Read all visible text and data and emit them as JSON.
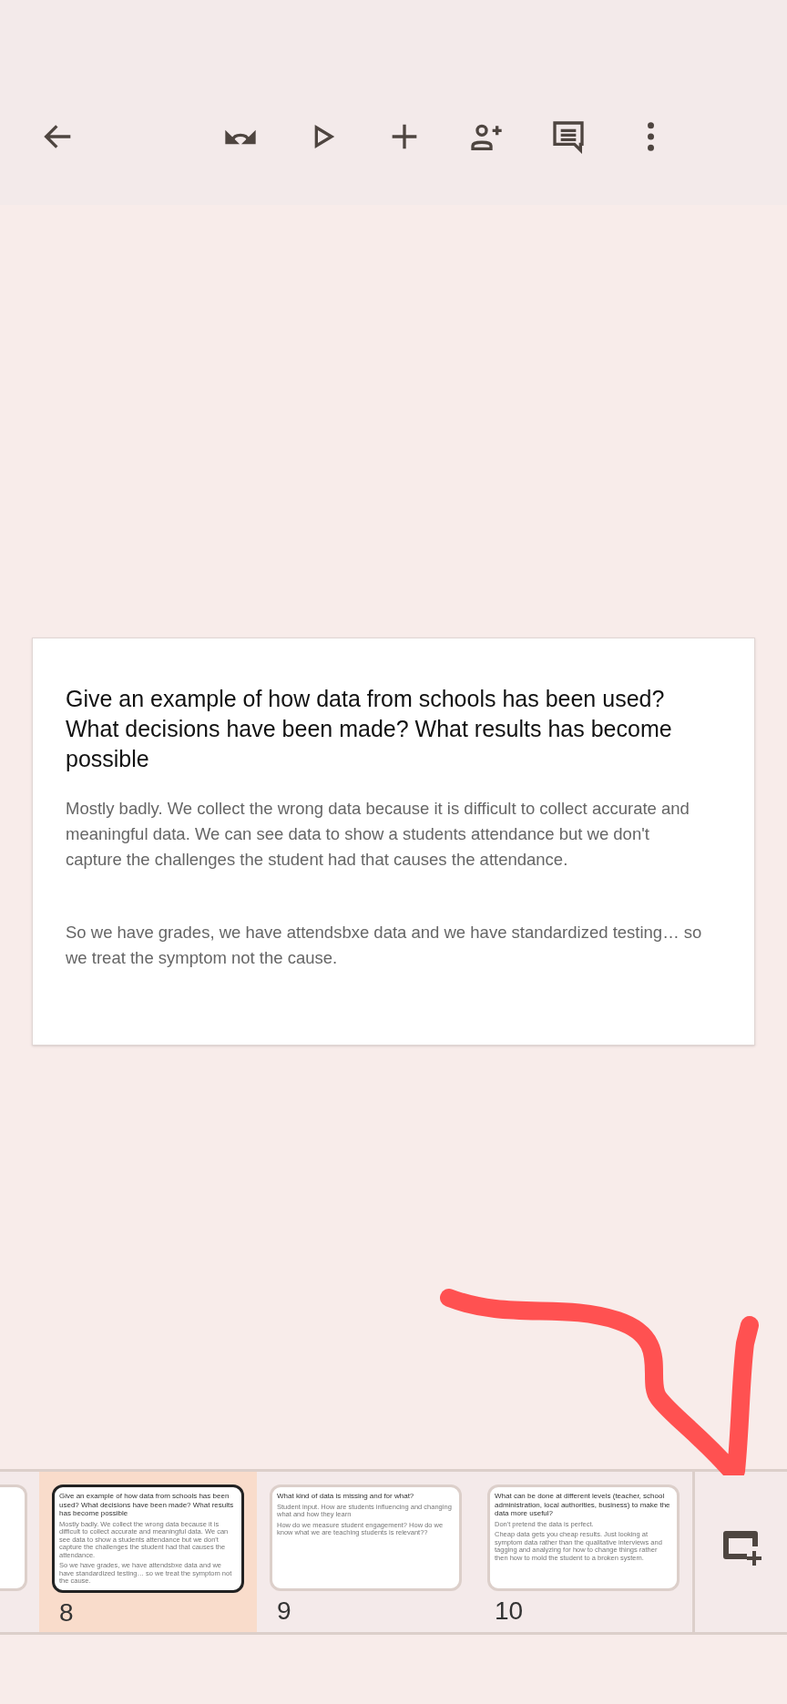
{
  "toolbar": {
    "buttons": [
      {
        "kind": "back"
      },
      {
        "kind": "undo"
      },
      {
        "kind": "play"
      },
      {
        "kind": "add"
      },
      {
        "kind": "share"
      },
      {
        "kind": "comments"
      },
      {
        "kind": "more"
      }
    ]
  },
  "slide": {
    "title": "Give an example of how data from schools has been used? What decisions have been made? What results has become possible",
    "paragraphs": [
      "Mostly badly. We collect the wrong data because it is difficult to collect accurate and meaningful data. We can see data to show a students attendance but we don't capture the challenges the student had that causes the attendance.",
      "So we have grades, we have attendsbxe data and we have standardized testing… so we treat the symptom not the cause."
    ]
  },
  "filmstrip": {
    "slides": [
      {
        "number": "8",
        "selected": true,
        "title": "Give an example of how data from schools has been used? What decisions have been made? What results has become possible",
        "paragraphs": [
          "Mostly badly. We collect the wrong data because it is difficult to collect accurate and meaningful data. We can see data to show a students attendance but we don't capture the challenges the student had that causes the attendance.",
          "So we have grades, we have attendsbxe data and we have standardized testing… so we treat the symptom not the cause."
        ]
      },
      {
        "number": "9",
        "selected": false,
        "title": "What kind of data is missing and for what?",
        "paragraphs": [
          "Student input. How are students influencing and changing what and how they learn",
          "How do we measure student engagement? How do we know what we are teaching students is relevant??"
        ]
      },
      {
        "number": "10",
        "selected": false,
        "title": "What can be done at different levels (teacher, school administration, local authorities, business) to make the data more useful?",
        "paragraphs": [
          "Don't pretend the data is perfect.",
          "Cheap data gets you cheap results. Just looking at symptom data rather than the qualitative interviews and tagging and analyzing for how to change things rather then how to mold the student to a broken system."
        ]
      }
    ]
  }
}
